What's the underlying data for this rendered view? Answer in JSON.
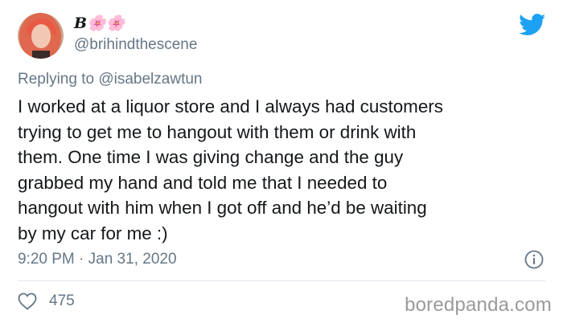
{
  "author": {
    "display_name": "B🌸🌸",
    "handle": "@brihindthescene"
  },
  "reply": {
    "prefix": "Replying to",
    "mention": "@isabelzawtun"
  },
  "tweet": {
    "text": "I worked at a liquor store and I always had customers\ntrying to get me to hangout with them or drink with\nthem. One time I was giving change and the guy\ngrabbed my hand and told me that I needed to\nhangout with him when I got off and he’d be waiting\nby my car for me :)",
    "timestamp": "9:20 PM · Jan 31, 2020",
    "like_count": "475"
  },
  "watermark": "boredpanda.com",
  "icons": {
    "brand": "twitter-bird-icon",
    "info": "info-icon",
    "like": "heart-icon"
  },
  "colors": {
    "twitter_blue": "#1da1f2",
    "secondary_text": "#657786",
    "primary_text": "#14171a"
  }
}
